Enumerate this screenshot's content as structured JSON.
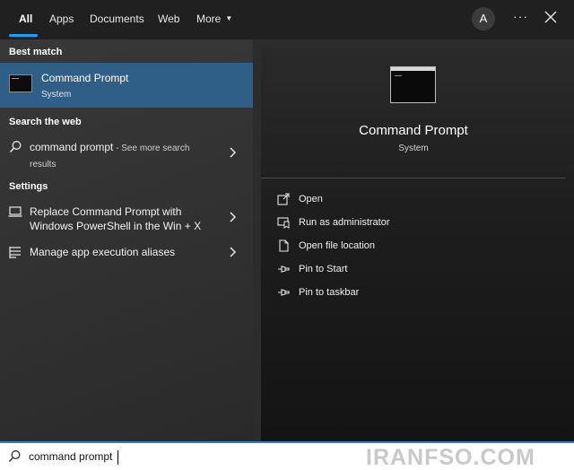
{
  "tabs": [
    {
      "label": "All"
    },
    {
      "label": "Apps"
    },
    {
      "label": "Documents"
    },
    {
      "label": "Web"
    },
    {
      "label": "More"
    }
  ],
  "header": {
    "avatar_letter": "A",
    "more_options": "···"
  },
  "left": {
    "best_match_title": "Best match",
    "best_match": {
      "name": "Command Prompt",
      "subtitle": "System"
    },
    "search_web_title": "Search the web",
    "web_result": {
      "query": "command prompt",
      "suffix": " - See more search",
      "suffix2": "results"
    },
    "settings_title": "Settings",
    "settings_items": [
      {
        "line1": "Replace Command Prompt with",
        "line2": "Windows PowerShell in the Win + X"
      },
      {
        "line1": "Manage app execution aliases"
      }
    ]
  },
  "right": {
    "title": "Command Prompt",
    "subtitle": "System",
    "actions": [
      {
        "label": "Open",
        "icon": "open-icon"
      },
      {
        "label": "Run as administrator",
        "icon": "shield-icon"
      },
      {
        "label": "Open file location",
        "icon": "file-icon"
      },
      {
        "label": "Pin to Start",
        "icon": "pin-icon"
      },
      {
        "label": "Pin to taskbar",
        "icon": "pin-icon"
      }
    ]
  },
  "search": {
    "value": "command prompt"
  },
  "watermark": "IRANFSO.COM",
  "colors": {
    "accent": "#1a9fff",
    "selected": "#2f5f86"
  }
}
